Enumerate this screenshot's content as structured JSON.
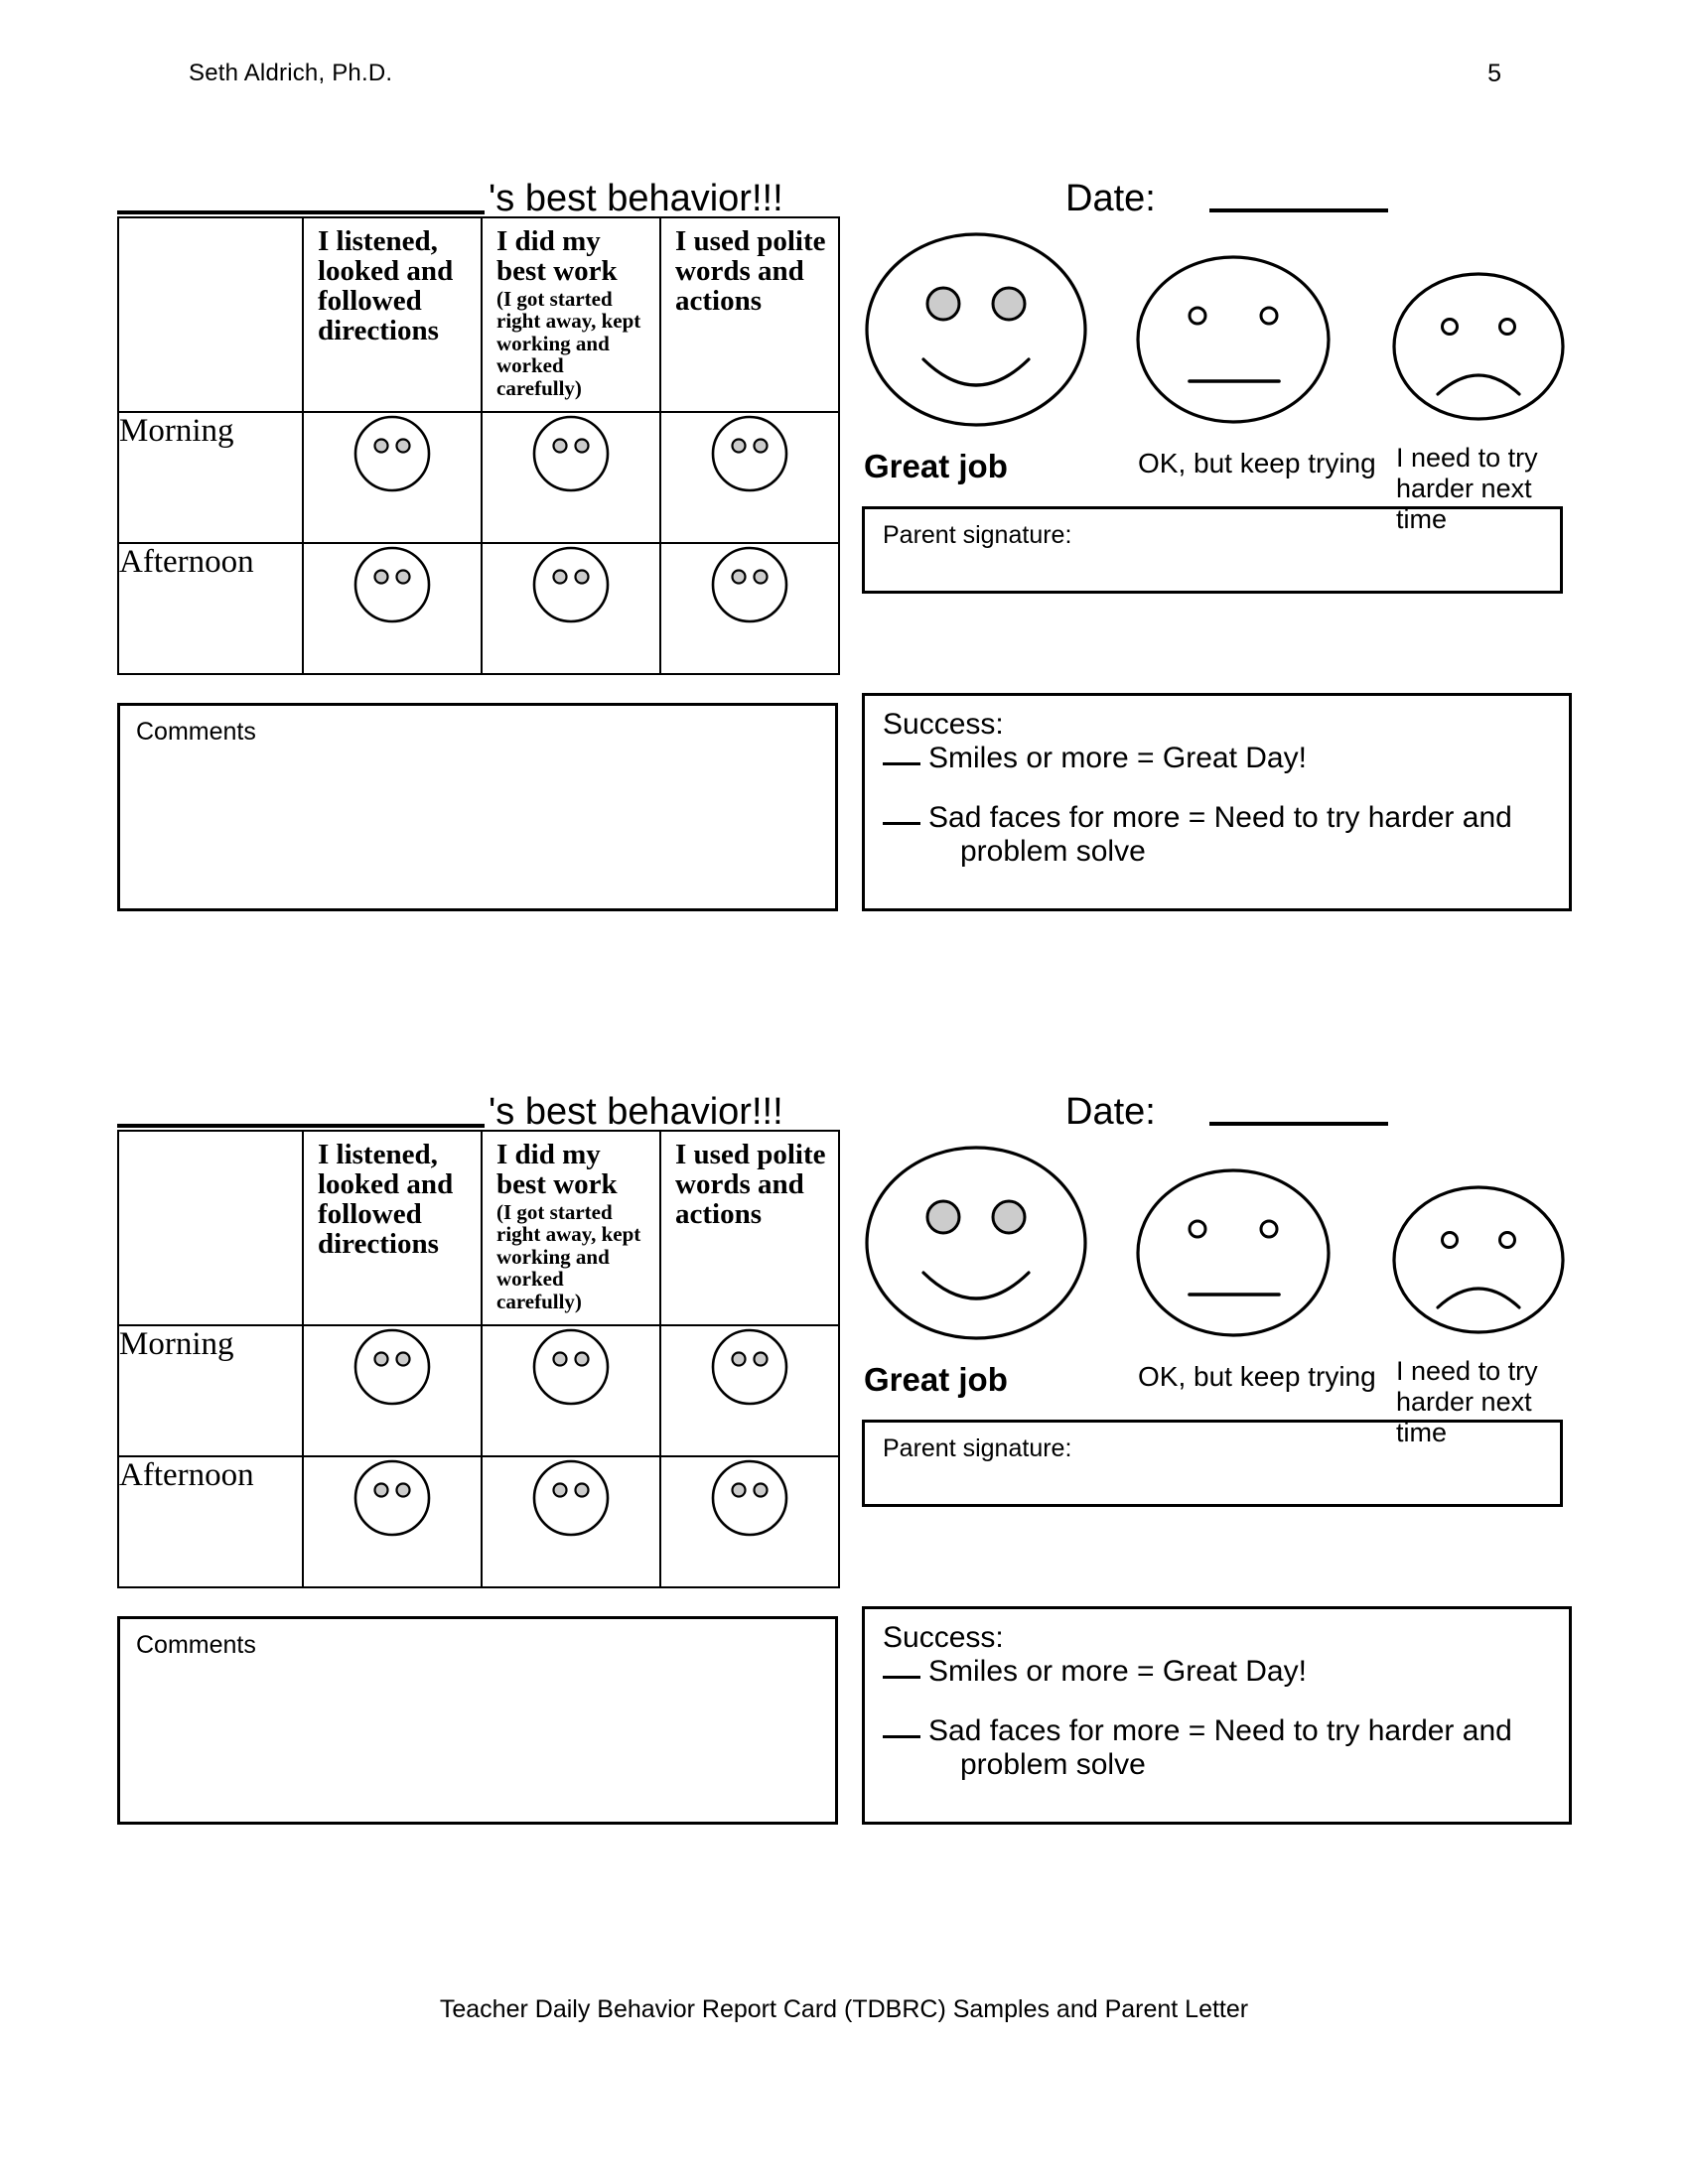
{
  "header": {
    "author": "Seth Aldrich, Ph.D.",
    "page_number": "5"
  },
  "footer": {
    "text": "Teacher Daily Behavior Report Card (TDBRC) Samples and Parent Letter"
  },
  "card": {
    "title_suffix": "'s best behavior!!!",
    "date_label": "Date:",
    "table": {
      "column_headers": [
        {
          "main": "I listened, looked and followed directions",
          "sub": ""
        },
        {
          "main": "I did my best work",
          "sub": "(I got started right away, kept working and worked carefully)"
        },
        {
          "main": "I used polite words and actions",
          "sub": ""
        }
      ],
      "row_labels": [
        "Morning",
        "Afternoon"
      ],
      "cell_rating_icons": [
        [
          "blank-face-icon",
          "blank-face-icon",
          "blank-face-icon"
        ],
        [
          "blank-face-icon",
          "blank-face-icon",
          "blank-face-icon"
        ]
      ]
    },
    "legend": [
      {
        "icon": "happy-face-icon",
        "caption": "Great job"
      },
      {
        "icon": "neutral-face-icon",
        "caption": "OK, but keep trying"
      },
      {
        "icon": "sad-face-icon",
        "caption": "I need to try harder next time"
      }
    ],
    "parent_signature_label": "Parent signature:",
    "comments_label": "Comments",
    "success": {
      "heading": "Success:",
      "line1": "Smiles or more = Great Day!",
      "line2": "Sad faces for more = Need to try harder and",
      "line2_cont": "problem solve"
    }
  },
  "colors": {
    "ink": "#000000",
    "paper": "#ffffff",
    "eye_fill": "#cccccc"
  }
}
